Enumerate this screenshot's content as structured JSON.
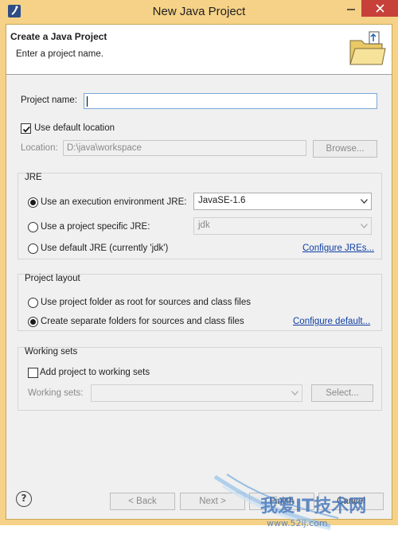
{
  "window": {
    "title": "New Java Project"
  },
  "banner": {
    "title": "Create a Java Project",
    "message": "Enter a project name.",
    "image": "new-java-project-folder-icon"
  },
  "project_name": {
    "label": "Project name:",
    "value": ""
  },
  "location": {
    "checkbox_label": "Use default location",
    "checked": true,
    "label": "Location:",
    "value": "D:\\java\\workspace",
    "browse_label": "Browse..."
  },
  "jre": {
    "title": "JRE",
    "options": [
      {
        "label": "Use an execution environment JRE:",
        "selected": true,
        "combo_value": "JavaSE-1.6",
        "combo_enabled": true
      },
      {
        "label": "Use a project specific JRE:",
        "selected": false,
        "combo_value": "jdk",
        "combo_enabled": false
      },
      {
        "label": "Use default JRE (currently 'jdk')",
        "selected": false,
        "link": "Configure JREs..."
      }
    ]
  },
  "layout": {
    "title": "Project layout",
    "options": [
      {
        "label": "Use project folder as root for sources and class files",
        "selected": false
      },
      {
        "label": "Create separate folders for sources and class files",
        "selected": true
      }
    ],
    "link": "Configure default..."
  },
  "working_sets": {
    "title": "Working sets",
    "checkbox_label": "Add project to working sets",
    "checked": false,
    "label": "Working sets:",
    "value": "",
    "select_label": "Select..."
  },
  "footer": {
    "help_label": "?",
    "back_label": "< Back",
    "next_label": "Next >",
    "finish_label": "Finish",
    "cancel_label": "Cancel"
  },
  "watermark": {
    "text": "我爱IT技术网",
    "url": "www.52ij.com"
  },
  "colors": {
    "frame": "#f5d287",
    "close": "#c7403a",
    "link": "#0f3ea4",
    "focus": "#7aa7d6"
  }
}
